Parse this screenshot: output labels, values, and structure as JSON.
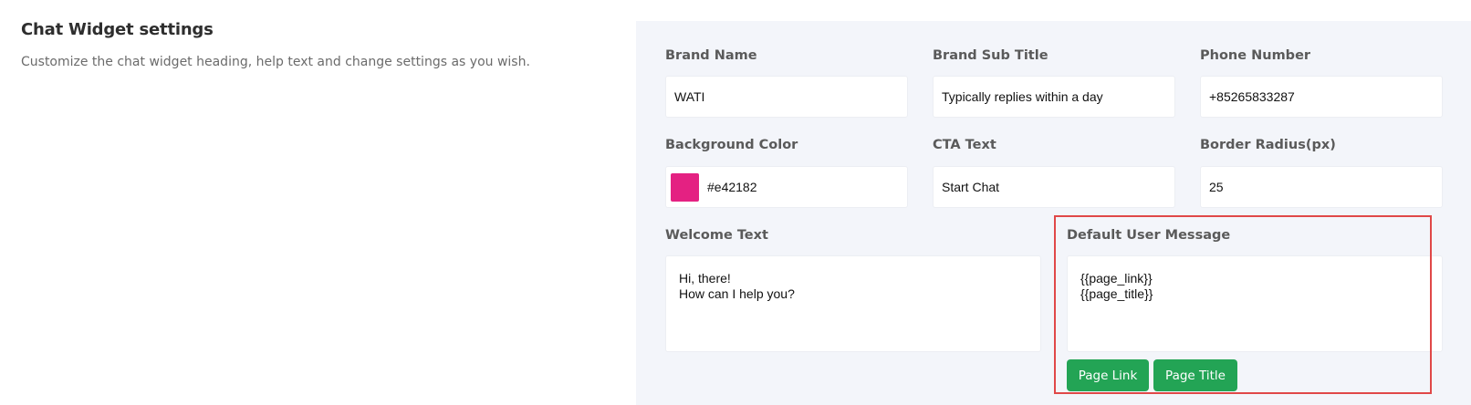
{
  "section": {
    "title": "Chat Widget settings",
    "description": "Customize the chat widget heading, help text and change settings as you wish."
  },
  "fields": {
    "brand_name": {
      "label": "Brand Name",
      "value": "WATI"
    },
    "brand_sub_title": {
      "label": "Brand Sub Title",
      "value": "Typically replies within a day"
    },
    "phone_number": {
      "label": "Phone Number",
      "value": "+85265833287"
    },
    "background_color": {
      "label": "Background Color",
      "value": "#e42182",
      "swatch": "#e42182"
    },
    "cta_text": {
      "label": "CTA Text",
      "value": "Start Chat"
    },
    "border_radius": {
      "label": "Border Radius(px)",
      "value": "25"
    },
    "welcome_text": {
      "label": "Welcome Text",
      "lines": [
        "Hi, there!",
        "How can I help you?"
      ]
    },
    "default_user_message": {
      "label": "Default User Message",
      "lines": [
        "{{page_link}}",
        "{{page_title}}"
      ]
    }
  },
  "buttons": {
    "page_link": "Page Link",
    "page_title": "Page Title"
  },
  "colors": {
    "panel_bg": "#f3f5fa",
    "button_green": "#23a455",
    "highlight_red": "#e04848"
  }
}
